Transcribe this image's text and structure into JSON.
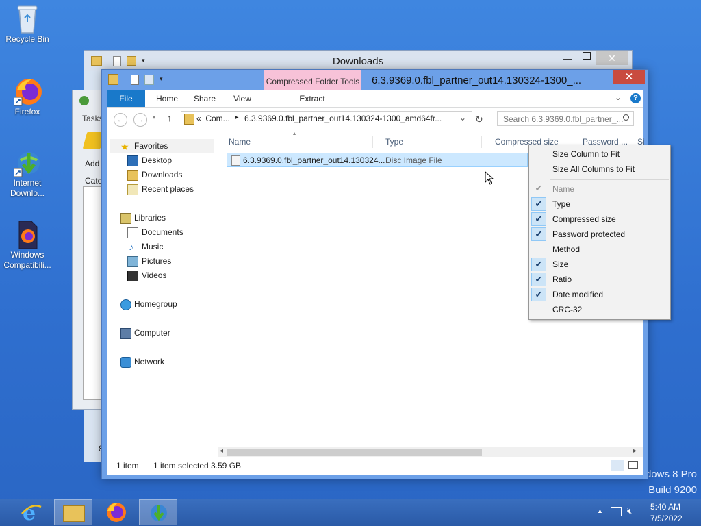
{
  "desktop": {
    "icons": [
      {
        "label": "Recycle Bin"
      },
      {
        "label": "Firefox"
      },
      {
        "label": "Internet Downlo..."
      },
      {
        "label": "Windows Compatibili..."
      }
    ],
    "watermark_line1": "dows 8 Pro",
    "watermark_line2": "Build 9200"
  },
  "back_window": {
    "title": "Downloads",
    "left_fragments": {
      "tasks": "Tasks",
      "add": "Add",
      "cate": "Cate",
      "num": "8"
    }
  },
  "window": {
    "context_tab": "Compressed Folder Tools",
    "title": "6.3.9369.0.fbl_partner_out14.130324-1300_...",
    "ribbon_tabs": [
      "File",
      "Home",
      "Share",
      "View",
      "Extract"
    ],
    "address_prefix": "«  Com...",
    "address_path": "6.3.9369.0.fbl_partner_out14.130324-1300_amd64fr...",
    "search_placeholder": "Search 6.3.9369.0.fbl_partner_...",
    "nav": {
      "favorites": "Favorites",
      "desktop": "Desktop",
      "downloads": "Downloads",
      "recent": "Recent places",
      "libraries": "Libraries",
      "documents": "Documents",
      "music": "Music",
      "pictures": "Pictures",
      "videos": "Videos",
      "homegroup": "Homegroup",
      "computer": "Computer",
      "network": "Network"
    },
    "columns": [
      "Name",
      "Type",
      "Compressed size",
      "Password ...",
      "Si"
    ],
    "files": [
      {
        "name": "6.3.9369.0.fbl_partner_out14.130324...",
        "type": "Disc Image File"
      }
    ],
    "status": {
      "count": "1 item",
      "selected": "1 item selected",
      "size": "3.59 GB"
    }
  },
  "context_menu": {
    "fit_column": "Size Column to Fit",
    "fit_all": "Size All Columns to Fit",
    "items": [
      {
        "label": "Name",
        "checked": true,
        "disabled": true
      },
      {
        "label": "Type",
        "checked": true,
        "disabled": false
      },
      {
        "label": "Compressed size",
        "checked": true,
        "disabled": false
      },
      {
        "label": "Password protected",
        "checked": true,
        "disabled": false
      },
      {
        "label": "Method",
        "checked": false,
        "disabled": false
      },
      {
        "label": "Size",
        "checked": true,
        "disabled": false
      },
      {
        "label": "Ratio",
        "checked": true,
        "disabled": false
      },
      {
        "label": "Date modified",
        "checked": true,
        "disabled": false
      },
      {
        "label": "CRC-32",
        "checked": false,
        "disabled": false
      }
    ]
  },
  "taskbar": {
    "time": "5:40 AM",
    "date": "7/5/2022"
  }
}
